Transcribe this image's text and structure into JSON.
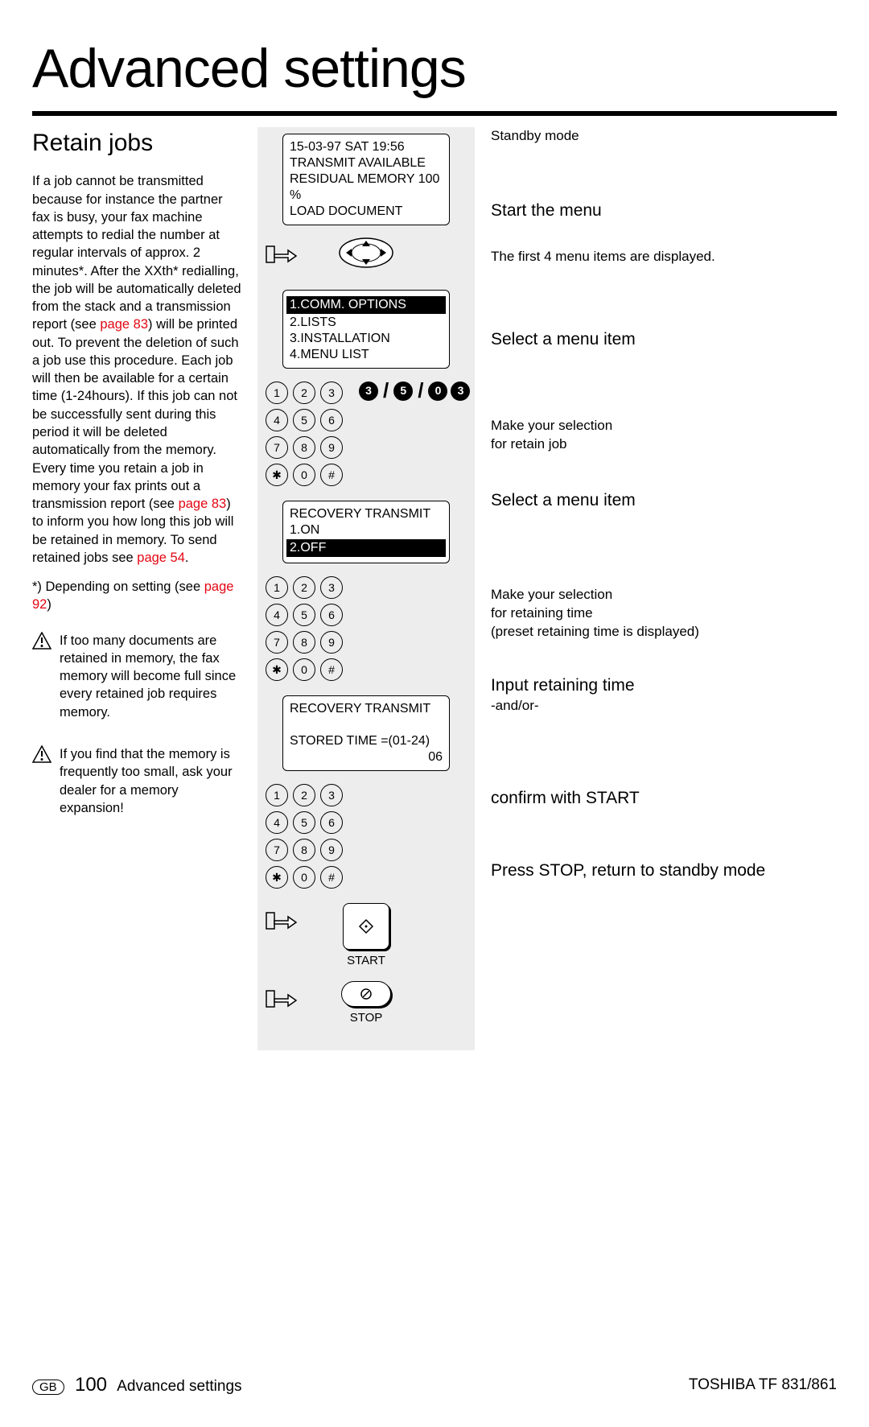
{
  "header": {
    "title": "Advanced settings"
  },
  "section": {
    "title": "Retain jobs"
  },
  "left": {
    "p1a": "If a job cannot be transmitted because for instance the partner fax is busy, your fax machine attempts to redial the number at regular intervals of approx. 2 minutes*. After the XXth* redialling, the job will be automatically deleted from the stack and a transmission report (see ",
    "p1link1": "page 83",
    "p1b": ") will be printed out. To prevent the deletion of such a job use this procedure. Each job will then be available for a certain time (1-24hours). If this job can not be successfully sent during this period it will be deleted automatically from the memory. Every time you retain a job in memory your fax prints out a transmission report (see ",
    "p1link2": "page 83",
    "p1c": ") to inform you how long this job will be retained in memory. To send retained jobs see ",
    "p1link3": "page 54",
    "p1d": ".",
    "foot_a": "*) Depending on setting (see ",
    "foot_link": "page 92",
    "foot_b": ")",
    "warn1": "If too many documents are retained in memory, the fax memory will become full since every retained job requires memory.",
    "warn2": "If you find that the memory is frequently too small, ask your dealer for a memory expansion!"
  },
  "lcd1": {
    "l1": "15-03-97   SAT   19:56",
    "l2": "TRANSMIT AVAILABLE",
    "l3": "RESIDUAL MEMORY 100 %",
    "l4": "LOAD DOCUMENT"
  },
  "lcd2": {
    "l1": "1.COMM. OPTIONS",
    "l2": "2.LISTS",
    "l3": "3.INSTALLATION",
    "l4": "4.MENU LIST"
  },
  "bignums": {
    "a": "3",
    "b": "5",
    "c": "0",
    "d": "3"
  },
  "lcd3": {
    "l1": "RECOVERY TRANSMIT",
    "l2": "1.ON",
    "l3": "2.OFF"
  },
  "lcd4": {
    "l1": "RECOVERY TRANSMIT",
    "l2": "STORED TIME =(01-24)",
    "l3": "06"
  },
  "labels": {
    "start": "START",
    "stop": "STOP"
  },
  "right": {
    "r0": "Standby mode",
    "r1": "Start the menu",
    "r2": "The first 4 menu items are displayed.",
    "r3": "Select a menu item",
    "r4a": "Make your selection",
    "r4b": "for retain job",
    "r5": "Select a menu item",
    "r6a": "Make your selection",
    "r6b": "for retaining time",
    "r6c": "(preset retaining time is displayed)",
    "r7": "Input retaining time",
    "r7b": "-and/or-",
    "r8": "confirm with START",
    "r9": "Press STOP, return to standby mode"
  },
  "footer": {
    "gb": "GB",
    "page": "100",
    "section": "Advanced settings",
    "model": "TOSHIBA  TF 831/861"
  }
}
